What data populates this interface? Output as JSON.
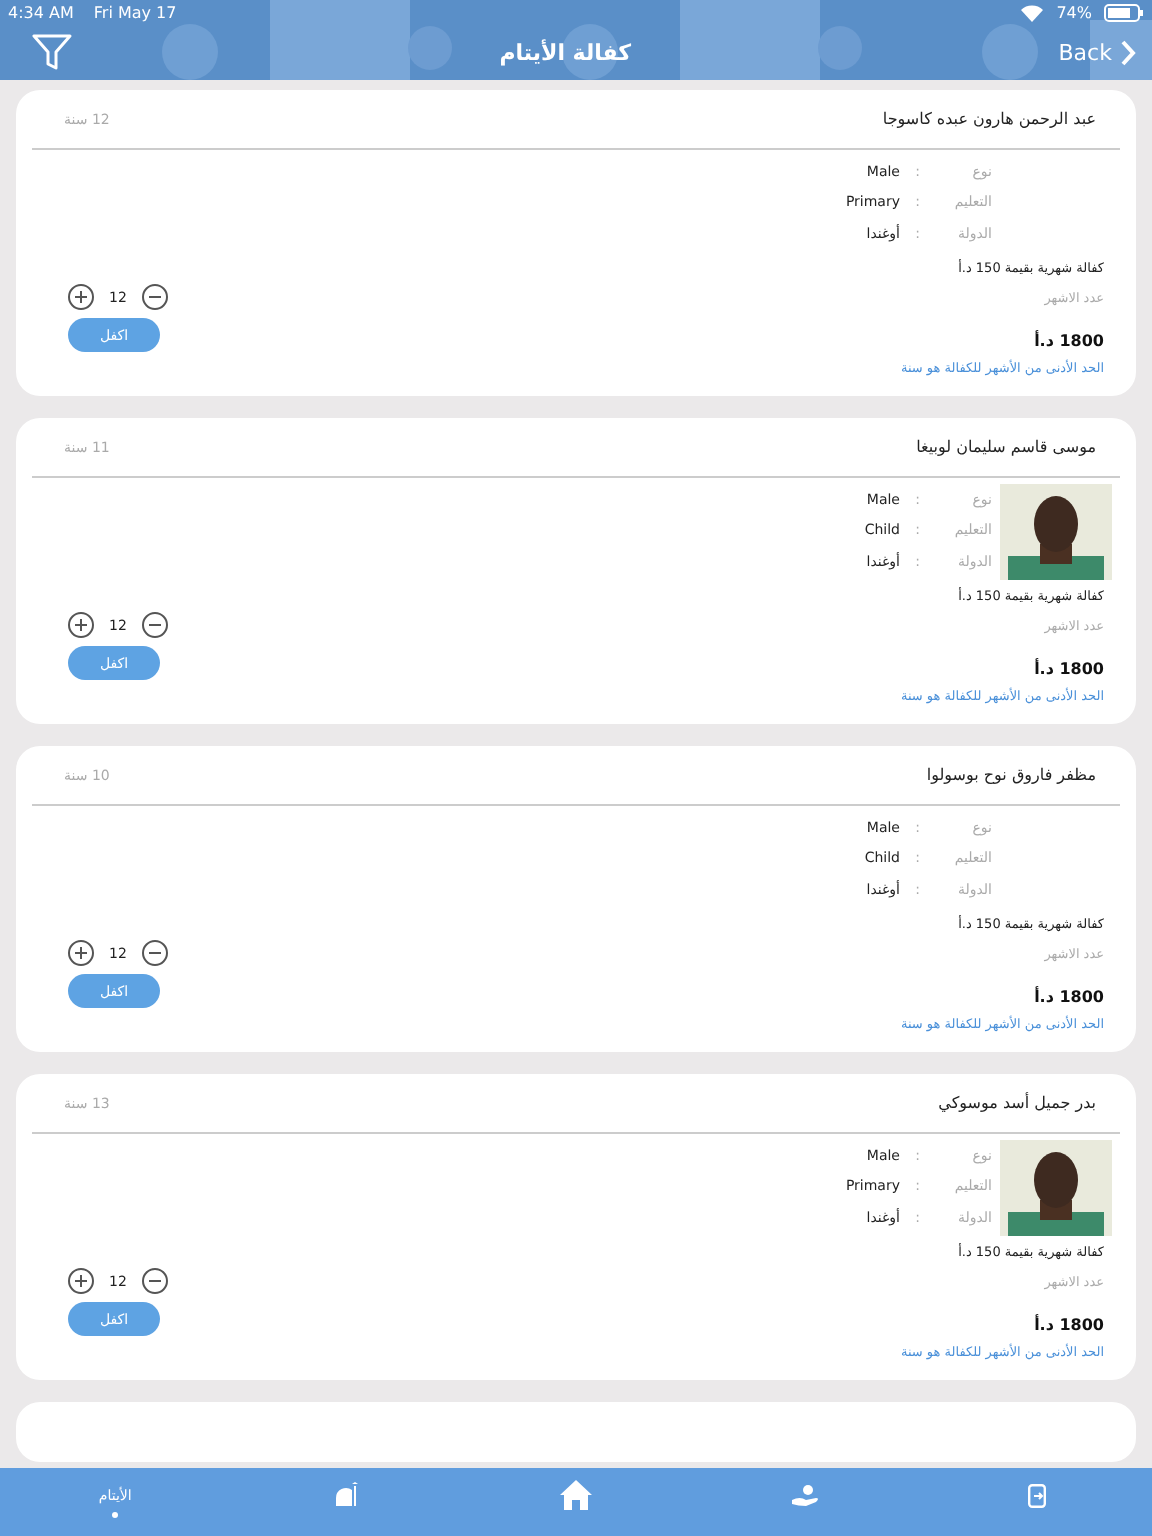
{
  "status_bar": {
    "time": "4:34 AM",
    "date": "Fri May 17",
    "battery": "74%"
  },
  "header": {
    "title": "كفالة الأيتام",
    "back": "Back"
  },
  "cards": [
    {
      "name": "عبد الرحمن هارون عبده كاسوجا",
      "age": "12 سنة",
      "has_photo": false,
      "fields": [
        {
          "label": "نوع",
          "separator": ":",
          "value": "Male"
        },
        {
          "label": "التعليم",
          "separator": ":",
          "value": "Primary"
        },
        {
          "label": "الدولة",
          "separator": ":",
          "value": "أوغندا"
        }
      ],
      "monthly": "كفالة شهرية بقيمة 150 د.أ",
      "months_label": "عدد الاشهر",
      "months": "12",
      "total": "1800 د.أ",
      "button": "اكفل",
      "note": "الحد الأدنى من الأشهر للكفالة هو سنة"
    },
    {
      "name": "موسى قاسم سليمان لوبيغا",
      "age": "11 سنة",
      "has_photo": true,
      "fields": [
        {
          "label": "نوع",
          "separator": ":",
          "value": "Male"
        },
        {
          "label": "التعليم",
          "separator": ":",
          "value": "Child"
        },
        {
          "label": "الدولة",
          "separator": ":",
          "value": "أوغندا"
        }
      ],
      "monthly": "كفالة شهرية بقيمة 150 د.أ",
      "months_label": "عدد الاشهر",
      "months": "12",
      "total": "1800 د.أ",
      "button": "اكفل",
      "note": "الحد الأدنى من الأشهر للكفالة هو سنة"
    },
    {
      "name": "مظفر فاروق نوح بوسولوا",
      "age": "10 سنة",
      "has_photo": false,
      "fields": [
        {
          "label": "نوع",
          "separator": ":",
          "value": "Male"
        },
        {
          "label": "التعليم",
          "separator": ":",
          "value": "Child"
        },
        {
          "label": "الدولة",
          "separator": ":",
          "value": "أوغندا"
        }
      ],
      "monthly": "كفالة شهرية بقيمة 150 د.أ",
      "months_label": "عدد الاشهر",
      "months": "12",
      "total": "1800 د.أ",
      "button": "اكفل",
      "note": "الحد الأدنى من الأشهر للكفالة هو سنة"
    },
    {
      "name": "بدر جميل أسد موسوكي",
      "age": "13 سنة",
      "has_photo": true,
      "fields": [
        {
          "label": "نوع",
          "separator": ":",
          "value": "Male"
        },
        {
          "label": "التعليم",
          "separator": ":",
          "value": "Primary"
        },
        {
          "label": "الدولة",
          "separator": ":",
          "value": "أوغندا"
        }
      ],
      "monthly": "كفالة شهرية بقيمة 150 د.أ",
      "months_label": "عدد الاشهر",
      "months": "12",
      "total": "1800 د.أ",
      "button": "اكفل",
      "note": "الحد الأدنى من الأشهر للكفالة هو سنة"
    }
  ],
  "tabs": [
    {
      "kind": "orphans",
      "label": "الأيتام",
      "selected": true
    },
    {
      "kind": "mosque",
      "selected": false
    },
    {
      "kind": "home",
      "selected": false
    },
    {
      "kind": "charity",
      "selected": false
    },
    {
      "kind": "logout",
      "selected": false
    }
  ]
}
